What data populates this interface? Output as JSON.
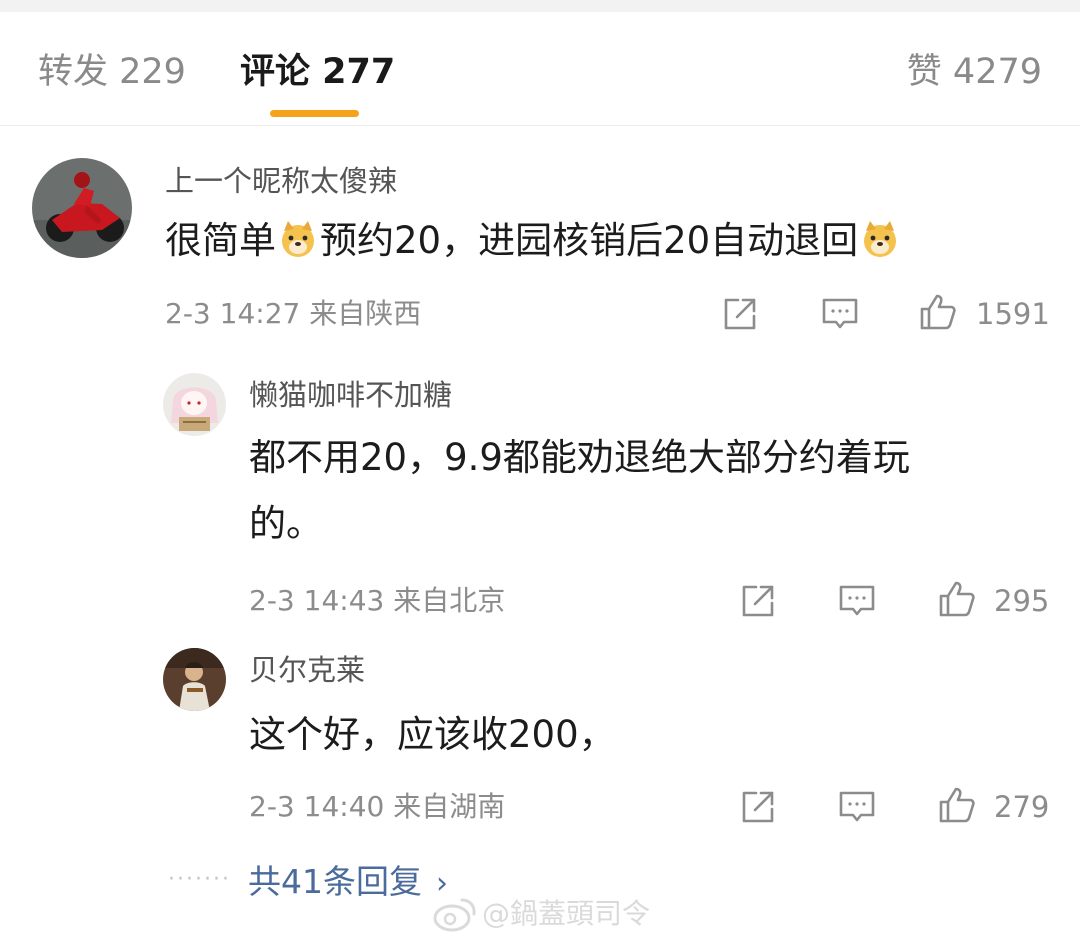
{
  "tabs": [
    {
      "label": "转发 229"
    },
    {
      "label": "评论 277"
    },
    {
      "label": "赞 4279"
    }
  ],
  "colors": {
    "accent": "#f7a21b",
    "link": "#4a6b9c",
    "meta": "#8c8c8c"
  },
  "main_comment": {
    "username": "上一个昵称太傻辣",
    "text_parts": [
      "很简单",
      "预约20，进园核销后20自动退回"
    ],
    "emoji": "doge-emoji",
    "meta": "2-3 14:27  来自陕西",
    "likes": "1591"
  },
  "replies": [
    {
      "username": "懒猫咖啡不加糖",
      "text_line1": "都不用20，9.9都能劝退绝大部分约着玩",
      "text_line2": "的。",
      "meta": "2-3 14:43  来自北京",
      "likes": "295"
    },
    {
      "username": "贝尔克莱",
      "text": "这个好，应该收200，",
      "meta": "2-3 14:40  来自湖南",
      "likes": "279"
    }
  ],
  "more_replies": {
    "label": "共41条回复",
    "dots": "·······"
  },
  "icons": [
    "share-icon",
    "comment-icon",
    "like-icon",
    "chevron-right-icon"
  ],
  "watermark": "@鍋蓋頭司令"
}
